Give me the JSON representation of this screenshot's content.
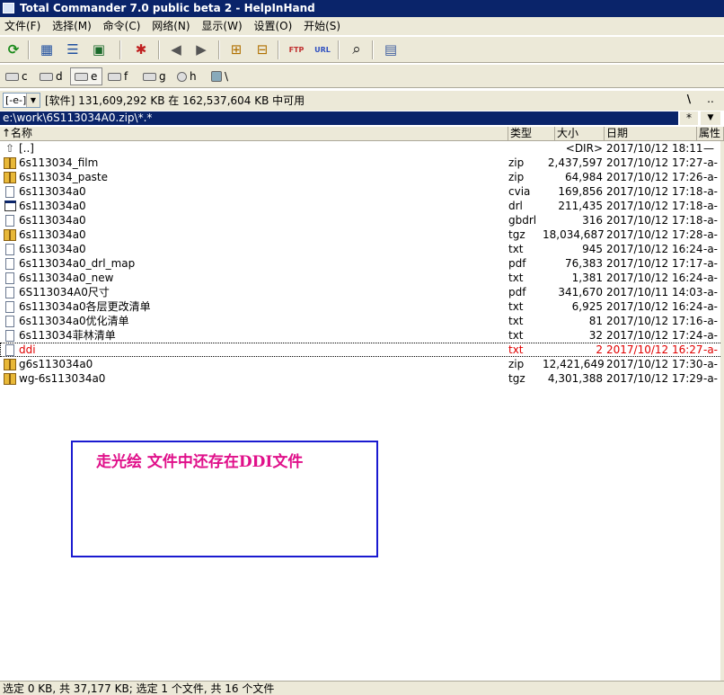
{
  "window": {
    "title": "Total Commander 7.0 public beta 2 - HelpInHand"
  },
  "menu": [
    "文件(F)",
    "选择(M)",
    "命令(C)",
    "网络(N)",
    "显示(W)",
    "设置(O)",
    "开始(S)"
  ],
  "toolbar": {
    "icons": [
      "refresh-icon",
      "brief-view-icon",
      "full-view-icon",
      "thumbnail-view-icon",
      "invert-selection-icon",
      "back-icon",
      "forward-icon",
      "pack-icon",
      "unpack-icon",
      "ftp-connect-icon",
      "url-connect-icon",
      "find-files-icon",
      "calculator-icon"
    ],
    "glyphs": {
      "refresh": "⟳",
      "brief": "▦",
      "full": "☰",
      "thumb": "▣",
      "invert": "✱",
      "back": "◀",
      "forward": "▶",
      "pack": "⊞",
      "unpack": "⊟",
      "ftp": "FTP",
      "url": "URL",
      "find": "⌕",
      "calc": "▤"
    }
  },
  "drives": [
    "c",
    "d",
    "e",
    "f",
    "g",
    "h",
    "\\"
  ],
  "active_drive": "e",
  "panel": {
    "drive_select": "[-e-]",
    "space_info": "[软件]  131,609,292 KB 在 162,537,604 KB 中可用",
    "root_label": "\\",
    "parent_label": "..",
    "path": "e:\\work\\6S113034A0.zip\\*.*",
    "history_label": "*",
    "hotlist_label": "▼"
  },
  "columns": {
    "name": "↑名称",
    "type": "类型",
    "size": "大小",
    "date": "日期",
    "attr": "属性"
  },
  "files": [
    {
      "icon": "up",
      "name": "[..]",
      "type": "",
      "size": "<DIR>",
      "date": "2017/10/12 18:11",
      "attr": "—"
    },
    {
      "icon": "zip",
      "name": "6s113034_film",
      "type": "zip",
      "size": "2,437,597",
      "date": "2017/10/12 17:27",
      "attr": "-a-"
    },
    {
      "icon": "zip",
      "name": "6s113034_paste",
      "type": "zip",
      "size": "64,984",
      "date": "2017/10/12 17:26",
      "attr": "-a-"
    },
    {
      "icon": "doc",
      "name": "6s113034a0",
      "type": "cvia",
      "size": "169,856",
      "date": "2017/10/12 17:18",
      "attr": "-a-"
    },
    {
      "icon": "win",
      "name": "6s113034a0",
      "type": "drl",
      "size": "211,435",
      "date": "2017/10/12 17:18",
      "attr": "-a-"
    },
    {
      "icon": "doc",
      "name": "6s113034a0",
      "type": "gbdrl",
      "size": "316",
      "date": "2017/10/12 17:18",
      "attr": "-a-"
    },
    {
      "icon": "zip",
      "name": "6s113034a0",
      "type": "tgz",
      "size": "18,034,687",
      "date": "2017/10/12 17:28",
      "attr": "-a-"
    },
    {
      "icon": "doc",
      "name": "6s113034a0",
      "type": "txt",
      "size": "945",
      "date": "2017/10/12 16:24",
      "attr": "-a-"
    },
    {
      "icon": "doc",
      "name": "6s113034a0_drl_map",
      "type": "pdf",
      "size": "76,383",
      "date": "2017/10/12 17:17",
      "attr": "-a-"
    },
    {
      "icon": "doc",
      "name": "6s113034a0_new",
      "type": "txt",
      "size": "1,381",
      "date": "2017/10/12 16:24",
      "attr": "-a-"
    },
    {
      "icon": "doc",
      "name": "6S113034A0尺寸",
      "type": "pdf",
      "size": "341,670",
      "date": "2017/10/11 14:03",
      "attr": "-a-"
    },
    {
      "icon": "doc",
      "name": "6s113034a0各层更改清单",
      "type": "txt",
      "size": "6,925",
      "date": "2017/10/12 16:24",
      "attr": "-a-"
    },
    {
      "icon": "doc",
      "name": "6s113034a0优化清单",
      "type": "txt",
      "size": "81",
      "date": "2017/10/12 17:16",
      "attr": "-a-"
    },
    {
      "icon": "doc",
      "name": "6s113034菲林清单",
      "type": "txt",
      "size": "32",
      "date": "2017/10/12 17:24",
      "attr": "-a-"
    },
    {
      "icon": "doc",
      "name": "ddi",
      "type": "txt",
      "size": "2",
      "date": "2017/10/12 16:27",
      "attr": "-a-",
      "highlight": true
    },
    {
      "icon": "zip",
      "name": "g6s113034a0",
      "type": "zip",
      "size": "12,421,649",
      "date": "2017/10/12 17:30",
      "attr": "-a-"
    },
    {
      "icon": "zip",
      "name": "wg-6s113034a0",
      "type": "tgz",
      "size": "4,301,388",
      "date": "2017/10/12 17:29",
      "attr": "-a-"
    }
  ],
  "annotation": {
    "text": "走光绘   文件中还存在DDI文件"
  },
  "status": "选定 0 KB, 共 37,177 KB; 选定 1 个文件, 共 16 个文件",
  "colors": {
    "title_bg": "#0a246a",
    "highlight_text": "#e00000",
    "annotation_text": "#e0108a",
    "annotation_border": "#1a1ad0"
  }
}
